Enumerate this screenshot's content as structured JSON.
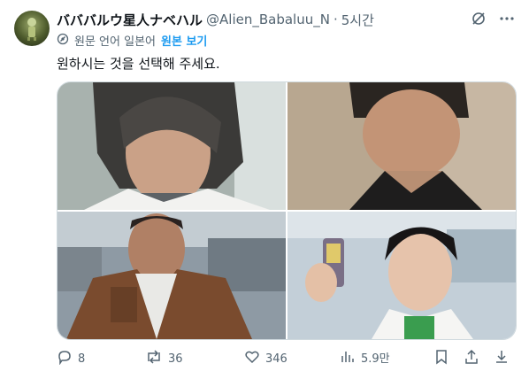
{
  "tweet": {
    "display_name": "バババルウ星人ナベハル",
    "handle": "@Alien_Babaluu_N",
    "separator": "·",
    "time": "5시간",
    "translation_note": "원문 언어 일본어",
    "show_original_label": "원본 보기",
    "text": "원하시는 것을 선택해 주세요.",
    "images": [
      {
        "name": "photo-1"
      },
      {
        "name": "photo-2"
      },
      {
        "name": "photo-3"
      },
      {
        "name": "photo-4"
      }
    ]
  },
  "actions": {
    "replies": "8",
    "reposts": "36",
    "likes": "346",
    "views": "5.9만"
  },
  "icons": {
    "grok": "grok-icon",
    "more": "more-icon",
    "translate": "translate-icon",
    "reply": "reply-icon",
    "repost": "repost-icon",
    "like": "like-icon",
    "views": "views-icon",
    "bookmark": "bookmark-icon",
    "share": "share-icon",
    "download": "download-icon"
  },
  "colors": {
    "link": "#1d9bf0",
    "text": "#0f1419",
    "secondary": "#536471"
  }
}
